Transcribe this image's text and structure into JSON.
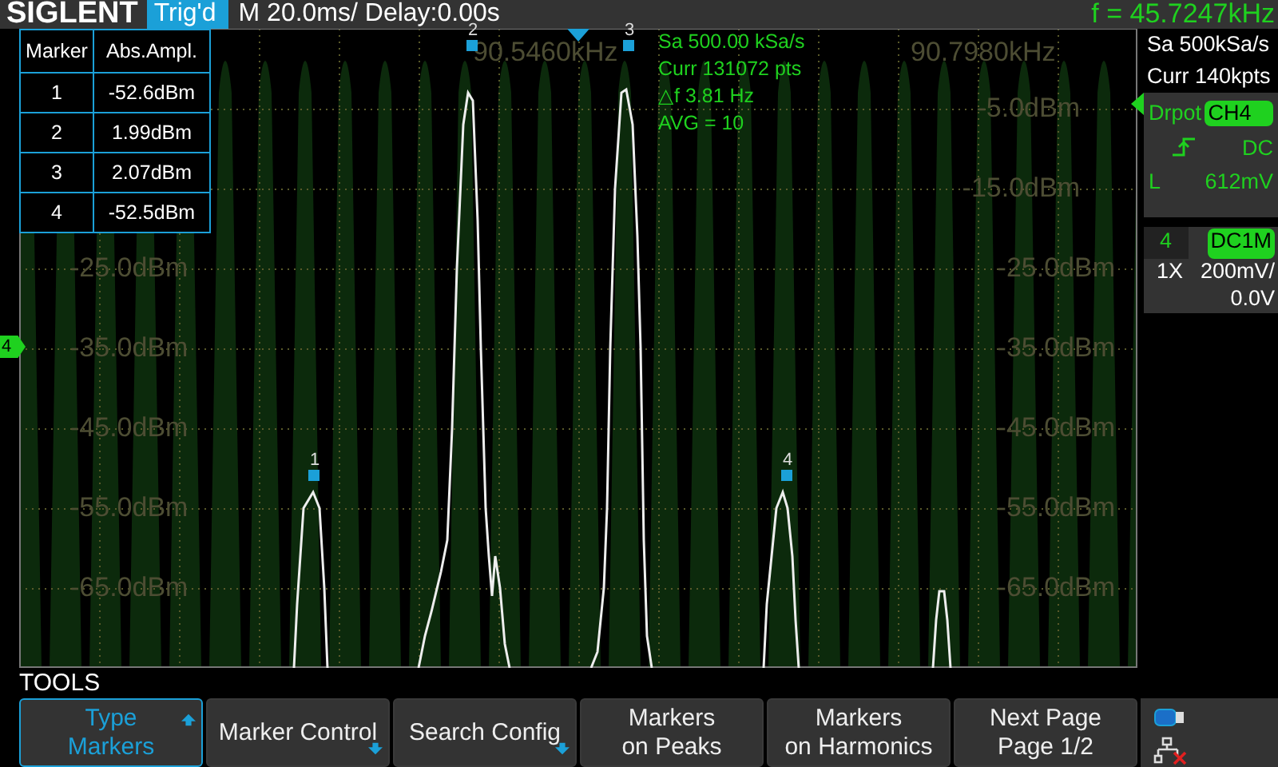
{
  "top_bar": {
    "logo": "SIGLENT",
    "trigger_status": "Trig'd",
    "timebase": "M 20.0ms/ Delay:0.00s",
    "frequency": "f = 45.7247kHz"
  },
  "display": {
    "freq_labels": [
      "90.5460kHz",
      "90.7980kHz"
    ],
    "amplitude_labels_left": [
      "-25.0dBm",
      "-35.0dBm",
      "-45.0dBm",
      "-55.0dBm",
      "-65.0dBm"
    ],
    "amplitude_labels_right": [
      "-5.0dBm",
      "-15.0dBm",
      "-25.0dBm",
      "-35.0dBm",
      "-45.0dBm",
      "-55.0dBm",
      "-65.0dBm"
    ],
    "channel_marker": "4",
    "markers": [
      {
        "label": "1"
      },
      {
        "label": "2"
      },
      {
        "label": "3"
      },
      {
        "label": "4"
      }
    ],
    "info": [
      "Sa 500.00 kSa/s",
      "Curr 131072 pts",
      "△f 3.81 Hz",
      "AVG = 10"
    ],
    "marker_table": {
      "columns": [
        "Marker",
        "Abs.Ampl."
      ],
      "rows": [
        [
          "1",
          "-52.6dBm"
        ],
        [
          "2",
          "1.99dBm"
        ],
        [
          "3",
          "2.07dBm"
        ],
        [
          "4",
          "-52.5dBm"
        ]
      ]
    }
  },
  "side_panel": {
    "sample_rate": "Sa 500kSa/s",
    "memory": "Curr 140kpts",
    "trigger": {
      "source": "Drpot",
      "channel": "CH4",
      "coupling": "DC",
      "level_label": "L",
      "level_value": "612mV"
    },
    "channel": {
      "number": "4",
      "coupling": "DC1M",
      "probe": "1X",
      "scale": "200mV/",
      "offset": "0.0V"
    }
  },
  "softkeys": {
    "title": "TOOLS",
    "buttons": [
      {
        "lines": [
          "Type",
          "Markers"
        ],
        "selected": true,
        "kind": "up"
      },
      {
        "lines": [
          "Marker Control"
        ],
        "selected": false,
        "kind": "down"
      },
      {
        "lines": [
          "Search Config"
        ],
        "selected": false,
        "kind": "down"
      },
      {
        "lines": [
          "Markers",
          "on Peaks"
        ],
        "selected": false,
        "kind": "plain"
      },
      {
        "lines": [
          "Markers",
          "on Harmonics"
        ],
        "selected": false,
        "kind": "plain"
      },
      {
        "lines": [
          "Next Page",
          "Page 1/2"
        ],
        "selected": false,
        "kind": "plain"
      }
    ]
  }
}
